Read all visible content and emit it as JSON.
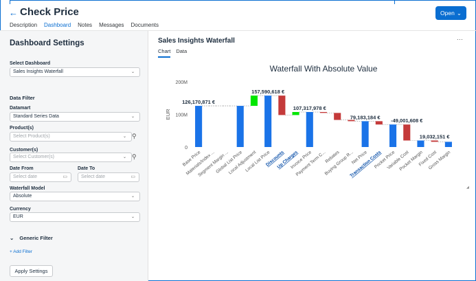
{
  "header": {
    "back_glyph": "←",
    "title": "Check Price",
    "open_label": "Open",
    "tabs": [
      "Description",
      "Dashboard",
      "Notes",
      "Messages",
      "Documents"
    ]
  },
  "sidebar": {
    "title": "Dashboard Settings",
    "select_dashboard_label": "Select Dashboard",
    "select_dashboard_value": "Sales Insights Waterfall",
    "data_filter_label": "Data Filter",
    "datamart_label": "Datamart",
    "datamart_value": "Standard Series Data",
    "products_label": "Product(s)",
    "products_placeholder": "Select Product(s)",
    "customers_label": "Customer(s)",
    "customers_placeholder": "Select Customer(s)",
    "date_from_label": "Date From",
    "date_to_label": "Date To",
    "date_placeholder": "Select date",
    "waterfall_model_label": "Waterfall Model",
    "waterfall_model_value": "Absolute",
    "currency_label": "Currency",
    "currency_value": "EUR",
    "generic_filter_label": "Generic Filter",
    "add_filter_label": "+ Add Filter",
    "apply_label": "Apply Settings"
  },
  "main": {
    "title": "Sales Insights Waterfall",
    "tabs": [
      "Chart",
      "Data"
    ]
  },
  "colors": {
    "accent": "#0a6ed1",
    "bar_total": "#1a73e8",
    "bar_up": "#00e600",
    "bar_down": "#c43a3a"
  },
  "chart_data": {
    "type": "bar",
    "title": "Waterfall With Absolute Value",
    "ylabel": "EUR",
    "xlabel": "",
    "ylim": [
      0,
      200000000
    ],
    "yticks": [
      "0",
      "100M",
      "200M"
    ],
    "categories": [
      "Base Price",
      "Materials/Index ...",
      "Segment Margin ...",
      "Global List Price",
      "Local Adjustment",
      "Local List Price",
      "Discounts",
      "Up Charges",
      "Invoice Price",
      "Payment Term C...",
      "Rebates",
      "Buying Group R...",
      "Net Price",
      "Transaction Costs",
      "Pocket Price",
      "Variable Cost",
      "Pocket Margin",
      "Fixed Cost",
      "Gross Margin"
    ],
    "linked_categories": [
      "Discounts",
      "Up Charges",
      "Transaction Costs"
    ],
    "bars": [
      {
        "kind": "total",
        "low": 0,
        "high": 126170871
      },
      {
        "kind": "flat",
        "low": 126170871,
        "high": 126170871
      },
      {
        "kind": "flat",
        "low": 126170871,
        "high": 126170871
      },
      {
        "kind": "total",
        "low": 0,
        "high": 126170871
      },
      {
        "kind": "up",
        "low": 126170871,
        "high": 157590618
      },
      {
        "kind": "total",
        "low": 0,
        "high": 157590618
      },
      {
        "kind": "down",
        "low": 98000000,
        "high": 157590618
      },
      {
        "kind": "up",
        "low": 98000000,
        "high": 107317978
      },
      {
        "kind": "total",
        "low": 0,
        "high": 107317978
      },
      {
        "kind": "down",
        "low": 104500000,
        "high": 107317978
      },
      {
        "kind": "down",
        "low": 83000000,
        "high": 104500000
      },
      {
        "kind": "down",
        "low": 79183184,
        "high": 83000000
      },
      {
        "kind": "total",
        "low": 0,
        "high": 79183184
      },
      {
        "kind": "down",
        "low": 69000000,
        "high": 79183184
      },
      {
        "kind": "total",
        "low": 0,
        "high": 69000000
      },
      {
        "kind": "down",
        "low": 20000000,
        "high": 69000000
      },
      {
        "kind": "total",
        "low": 0,
        "high": 20000000
      },
      {
        "kind": "down",
        "low": 16000000,
        "high": 20000000
      },
      {
        "kind": "total",
        "low": 0,
        "high": 16000000
      }
    ],
    "annotations": [
      {
        "text": "126,170,871 €",
        "index": 0
      },
      {
        "text": "157,590,618 €",
        "index": 5
      },
      {
        "text": "107,317,978 €",
        "index": 8
      },
      {
        "text": "79,183,184 €",
        "index": 12
      },
      {
        "text": "-49,001,608 €",
        "index": 15
      },
      {
        "text": "19,032,151 €",
        "index": 17
      }
    ]
  }
}
